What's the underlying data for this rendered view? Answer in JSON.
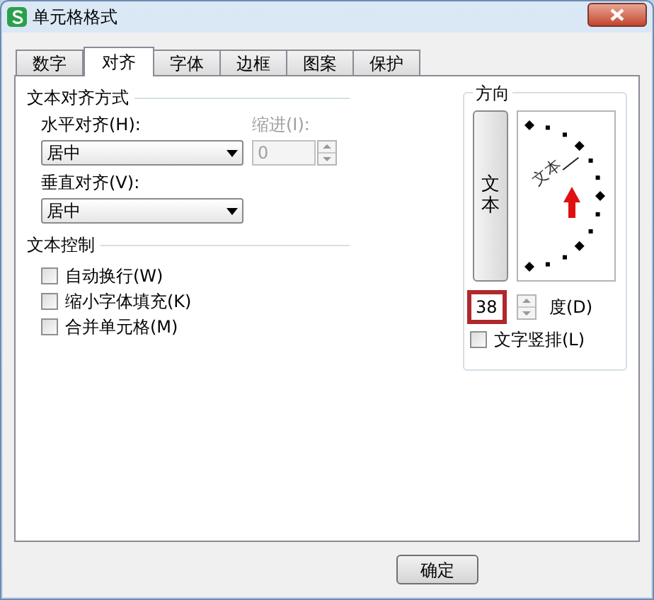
{
  "window": {
    "title": "单元格格式"
  },
  "tabs": [
    {
      "label": "数字",
      "selected": false
    },
    {
      "label": "对齐",
      "selected": true
    },
    {
      "label": "字体",
      "selected": false
    },
    {
      "label": "边框",
      "selected": false
    },
    {
      "label": "图案",
      "selected": false
    },
    {
      "label": "保护",
      "selected": false
    }
  ],
  "alignment": {
    "heading": "文本对齐方式",
    "horizontal": {
      "label": "水平对齐(H):",
      "value": "居中"
    },
    "indent": {
      "label": "缩进(I):",
      "value": "0",
      "disabled": true
    },
    "vertical": {
      "label": "垂直对齐(V):",
      "value": "居中"
    }
  },
  "text_control": {
    "heading": "文本控制",
    "options": [
      {
        "label": "自动换行(W)",
        "checked": false
      },
      {
        "label": "缩小字体填充(K)",
        "checked": false
      },
      {
        "label": "合并单元格(M)",
        "checked": false
      }
    ]
  },
  "orientation": {
    "heading": "方向",
    "vertical_text_button": "文本",
    "dial_text": "文本",
    "degrees": {
      "value": "38",
      "highlighted": true
    },
    "degrees_label": "度(D)",
    "vertical_stacking": {
      "label": "文字竖排(L)",
      "checked": false
    }
  },
  "buttons": [
    "确定"
  ]
}
